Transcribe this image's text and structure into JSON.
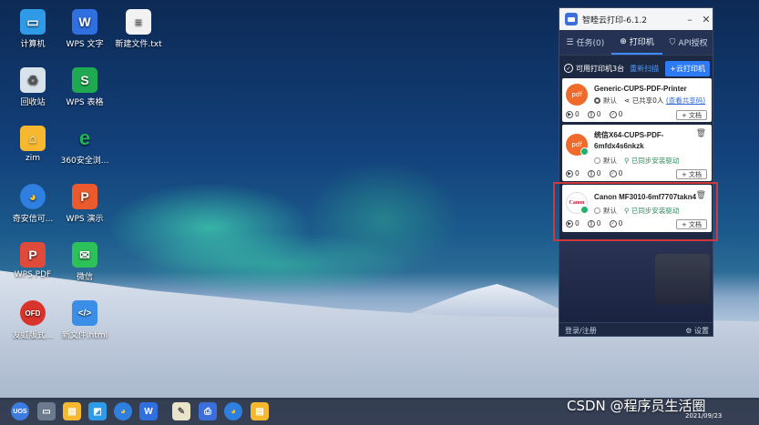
{
  "desktop": {
    "icons": [
      {
        "label": "计算机",
        "icon": "computer-icon",
        "color": "#2f9ae6",
        "glyph": "▭"
      },
      {
        "label": "WPS 文字",
        "icon": "wps-writer-icon",
        "color": "#2f6fe0",
        "glyph": "W"
      },
      {
        "label": "新建文件.txt",
        "icon": "text-file-icon",
        "color": "#f2f2f2",
        "glyph": "≡"
      },
      {
        "label": "回收站",
        "icon": "recycle-bin-icon",
        "color": "#d8e2ea",
        "glyph": "🗑"
      },
      {
        "label": "WPS 表格",
        "icon": "wps-spreadsheet-icon",
        "color": "#1faa52",
        "glyph": "S"
      },
      {
        "label": "zim",
        "icon": "folder-icon",
        "color": "#f5b82e",
        "glyph": "⌂"
      },
      {
        "label": "360安全浏...",
        "icon": "browser-360-icon",
        "color": "#1fb25a",
        "glyph": "e"
      },
      {
        "label": "奇安信可...",
        "icon": "qianxin-browser-icon",
        "color": "#2f7fe0",
        "glyph": "◕"
      },
      {
        "label": "WPS 演示",
        "icon": "wps-presentation-icon",
        "color": "#ea5a2d",
        "glyph": "P"
      },
      {
        "label": "WPS PDF",
        "icon": "wps-pdf-icon",
        "color": "#e04a3a",
        "glyph": "P"
      },
      {
        "label": "微信",
        "icon": "wechat-icon",
        "color": "#2dc15a",
        "glyph": "✉"
      },
      {
        "label": "友虹版式...",
        "icon": "ofd-reader-icon",
        "color": "#d9342b",
        "glyph": "OFD"
      },
      {
        "label": "新文件.html",
        "icon": "html-file-icon",
        "color": "#3a8ee6",
        "glyph": "</>"
      }
    ]
  },
  "taskbar": {
    "items": [
      {
        "name": "start-icon",
        "color": "#3c7be0",
        "glyph": "UOS"
      },
      {
        "name": "multitask-icon",
        "color": "#6c7a90",
        "glyph": "▭"
      },
      {
        "name": "file-manager-icon",
        "color": "#f5b82e",
        "glyph": "▤"
      },
      {
        "name": "app-store-icon",
        "color": "#2f9ae6",
        "glyph": "◩"
      },
      {
        "name": "browser-icon",
        "color": "#2f7fe0",
        "glyph": "◕"
      },
      {
        "name": "wps-icon",
        "color": "#2f6fe0",
        "glyph": "W"
      },
      {
        "name": "notes-icon",
        "color": "#e8e3c9",
        "glyph": "✎"
      },
      {
        "name": "print-app-icon",
        "color": "#3c6fd9",
        "glyph": "⎙"
      },
      {
        "name": "browser2-icon",
        "color": "#2f7fe0",
        "glyph": "◕"
      },
      {
        "name": "folder-icon",
        "color": "#f5b82e",
        "glyph": "▤"
      }
    ],
    "date": "2021/09/23"
  },
  "watermark": "CSDN @程序员生活圈",
  "app": {
    "title": "智睦云打印-6.1.2",
    "minimize": "–",
    "close": "✕",
    "tabs": [
      {
        "label": "任务(0)",
        "icon": "☰"
      },
      {
        "label": "打印机",
        "icon": "⊕"
      },
      {
        "label": "API授权",
        "icon": "⛉"
      }
    ],
    "status": {
      "available": "可用打印机3台",
      "rescan": "重新扫描",
      "add_cloud": "+云打印机"
    },
    "printers": [
      {
        "name": "Generic-CUPS-PDF-Printer",
        "avatar_text": "pdf",
        "avatar_color": "#f06a2c",
        "default_label": "默认",
        "is_default": true,
        "share_text": "已共享0人",
        "share_link": "(查看共享码)",
        "stats": [
          "0",
          "0",
          "0"
        ],
        "doc_button": "+ 文档"
      },
      {
        "name_line1": "统信X64-CUPS-PDF-",
        "name_line2": "6mfdx4s6nkzk",
        "avatar_text": "pdf",
        "avatar_color": "#f06a2c",
        "default_label": "默认",
        "is_default": false,
        "sync_text": "已同步安装驱动",
        "stats": [
          "0",
          "0",
          "0"
        ],
        "doc_button": "+ 文档"
      },
      {
        "name": "Canon MF3010-6mf7707takn4",
        "avatar_text": "Canon",
        "avatar_color": "#ffffff",
        "default_label": "默认",
        "is_default": false,
        "sync_text": "已同步安装驱动",
        "stats": [
          "0",
          "0",
          "0"
        ],
        "doc_button": "+ 文档"
      }
    ],
    "footer": {
      "login": "登录/注册",
      "settings": "设置"
    }
  }
}
